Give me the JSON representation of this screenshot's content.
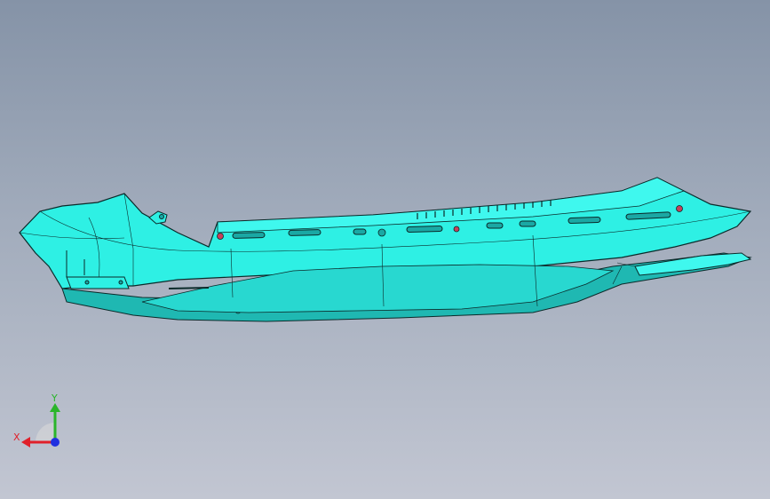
{
  "viewport": {
    "background_top": "#8593a7",
    "background_bottom": "#c2c6d2"
  },
  "model": {
    "face_color": "#2ef0e4",
    "edge_color": "#0b2a2a",
    "shadow_color": "#1aa8a4",
    "hole_color": "#c8405a"
  },
  "triad": {
    "x_label": "X",
    "y_label": "Y",
    "x_color": "#e0202a",
    "y_color": "#2ab52a",
    "z_color": "#2030e0"
  }
}
